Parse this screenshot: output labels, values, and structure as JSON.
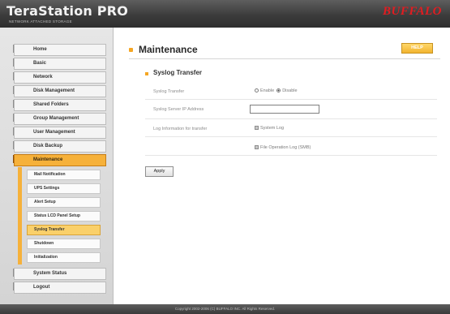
{
  "header": {
    "brand": "TeraStation PRO",
    "brand_subtitle": "NETWORK ATTACHED STORAGE",
    "vendor_logo": "BUFFALO"
  },
  "sidebar": {
    "items": [
      {
        "label": "Home",
        "icon": "home-icon"
      },
      {
        "label": "Basic",
        "icon": "basic-icon"
      },
      {
        "label": "Network",
        "icon": "network-icon"
      },
      {
        "label": "Disk Management",
        "icon": "disk-icon"
      },
      {
        "label": "Shared Folders",
        "icon": "folder-icon"
      },
      {
        "label": "Group Management",
        "icon": "group-icon"
      },
      {
        "label": "User Management",
        "icon": "user-icon"
      },
      {
        "label": "Disk Backup",
        "icon": "backup-icon"
      },
      {
        "label": "Maintenance",
        "icon": "maintenance-icon",
        "active": true
      },
      {
        "label": "System Status",
        "icon": "status-icon"
      },
      {
        "label": "Logout",
        "icon": "logout-icon"
      }
    ],
    "sub_items": [
      {
        "label": "Mail Notification"
      },
      {
        "label": "UPS Settings"
      },
      {
        "label": "Alert Setup"
      },
      {
        "label": "Status LCD Panel Setup"
      },
      {
        "label": "Syslog Transfer",
        "active": true
      },
      {
        "label": "Shutdown"
      },
      {
        "label": "Initialization"
      }
    ]
  },
  "main": {
    "title": "Maintenance",
    "help_label": "HELP",
    "section_title": "Syslog Transfer",
    "syslog_transfer_label": "Syslog Transfer",
    "enable_label": "Enable",
    "disable_label": "Disable",
    "selected_option": "Disable",
    "server_ip_label": "Syslog Server IP Address",
    "server_ip_value": "",
    "log_info_label": "Log Information for transfer",
    "system_log_label": "System Log",
    "file_operation_log_label": "File Operation Log (SMB)",
    "apply_label": "Apply"
  },
  "footer": {
    "copyright": "Copyright 2002-2006 (C) BUFFALO INC. All Rights Reserved."
  },
  "colors": {
    "accent": "#f6b13a",
    "header_bg": "#3c3c3c",
    "brand_red": "#e21c21"
  }
}
